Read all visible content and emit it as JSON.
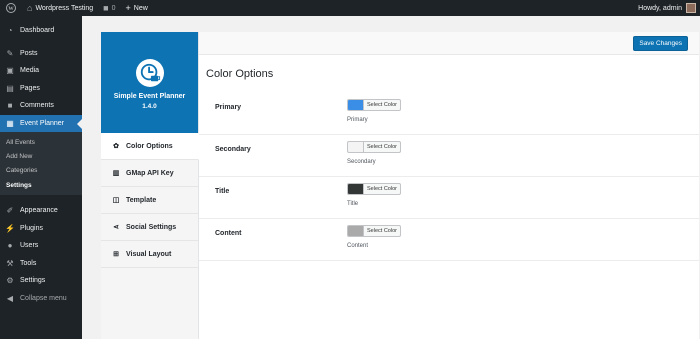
{
  "admin_bar": {
    "site_name": "Wordpress Testing",
    "comments_count": "0",
    "new_label": "New",
    "greeting": "Howdy, admin"
  },
  "sidebar": {
    "items": [
      {
        "label": "Dashboard",
        "icon": "dashboard-icon"
      },
      {
        "label": "Posts",
        "icon": "pin-icon"
      },
      {
        "label": "Media",
        "icon": "media-icon"
      },
      {
        "label": "Pages",
        "icon": "pages-icon"
      },
      {
        "label": "Comments",
        "icon": "comment-icon"
      },
      {
        "label": "Event Planner",
        "icon": "calendar-icon"
      }
    ],
    "submenu": [
      "All Events",
      "Add New",
      "Categories",
      "Settings"
    ],
    "lower_items": [
      {
        "label": "Appearance",
        "icon": "brush-icon"
      },
      {
        "label": "Plugins",
        "icon": "plugin-icon"
      },
      {
        "label": "Users",
        "icon": "users-icon"
      },
      {
        "label": "Tools",
        "icon": "wrench-icon"
      },
      {
        "label": "Settings",
        "icon": "settings-icon"
      }
    ],
    "collapse_label": "Collapse menu"
  },
  "plugin": {
    "name": "Simple Event Planner",
    "version": "1.4.0",
    "save_label": "Save Changes",
    "nav": [
      {
        "label": "Color Options",
        "icon": "gear-icon"
      },
      {
        "label": "GMap API Key",
        "icon": "map-icon"
      },
      {
        "label": "Template",
        "icon": "columns-icon"
      },
      {
        "label": "Social Settings",
        "icon": "share-icon"
      },
      {
        "label": "Visual Layout",
        "icon": "grid-icon"
      }
    ]
  },
  "color_options": {
    "title": "Color Options",
    "select_label": "Select Color",
    "rows": [
      {
        "label": "Primary",
        "desc": "Primary",
        "color": "#3a8ee6"
      },
      {
        "label": "Secondary",
        "desc": "Secondary",
        "color": "#f4f4f4"
      },
      {
        "label": "Title",
        "desc": "Title",
        "color": "#333836"
      },
      {
        "label": "Content",
        "desc": "Content",
        "color": "#aaaaaa"
      }
    ]
  },
  "colors": {
    "admin_dark": "#1d2327",
    "accent": "#2271b1",
    "brand_blue": "#0d73b3"
  }
}
